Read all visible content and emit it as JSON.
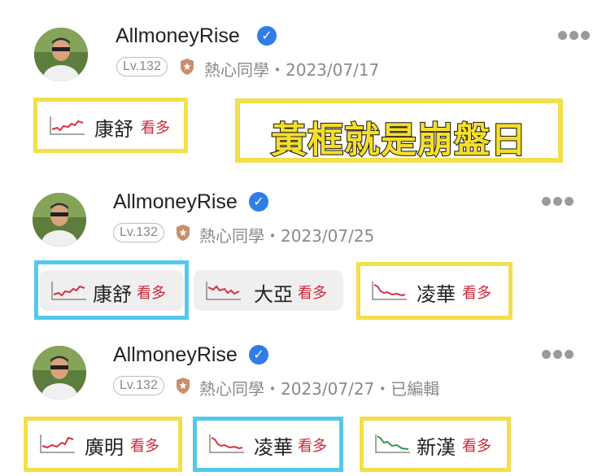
{
  "posts": [
    {
      "author": "AllmoneyRise",
      "level": "Lv.132",
      "badge": "熱心同學",
      "date": "2023/07/17",
      "edited": "",
      "stocks": [
        {
          "name": "康舒",
          "action": "看多",
          "trend": "up",
          "frame": "yellow"
        }
      ]
    },
    {
      "author": "AllmoneyRise",
      "level": "Lv.132",
      "badge": "熱心同學",
      "date": "2023/07/25",
      "edited": "",
      "stocks": [
        {
          "name": "康舒",
          "action": "看多",
          "trend": "up",
          "frame": "blue"
        },
        {
          "name": "大亞",
          "action": "看多",
          "trend": "down",
          "frame": "none"
        },
        {
          "name": "凌華",
          "action": "看多",
          "trend": "down",
          "frame": "yellow"
        }
      ]
    },
    {
      "author": "AllmoneyRise",
      "level": "Lv.132",
      "badge": "熱心同學",
      "date": "2023/07/27",
      "edited": "已編輯",
      "stocks": [
        {
          "name": "廣明",
          "action": "看多",
          "trend": "up",
          "frame": "yellow"
        },
        {
          "name": "凌華",
          "action": "看多",
          "trend": "down",
          "frame": "blue"
        },
        {
          "name": "新漢",
          "action": "看多",
          "trend": "down-green",
          "frame": "yellow"
        }
      ]
    }
  ],
  "annotation": "黃框就是崩盤日",
  "separator": "・",
  "colors": {
    "yellow_frame": "#f3df4a",
    "blue_frame": "#52c9ee",
    "bullish_red": "#c9283a",
    "verified_blue": "#2f7ee8",
    "trend_green": "#2e9a4a"
  },
  "icons": [
    "verified-icon",
    "shield-badge-icon",
    "more-options-icon",
    "trend-chart-icon"
  ]
}
